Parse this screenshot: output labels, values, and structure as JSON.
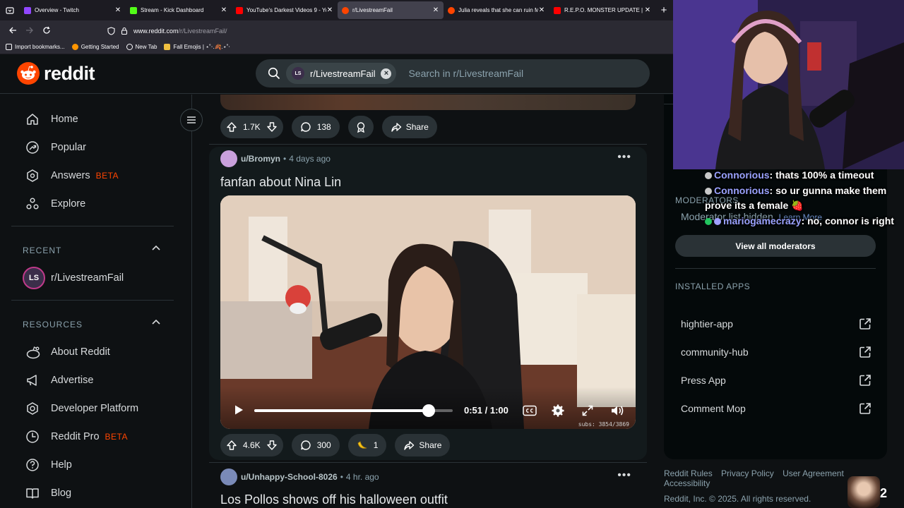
{
  "browser": {
    "tabs": [
      {
        "label": "Overview - Twitch",
        "color": "#9147ff",
        "active": false
      },
      {
        "label": "Stream - Kick Dashboard",
        "color": "#53fc18",
        "active": false
      },
      {
        "label": "YouTube's Darkest Videos 9 - Yo",
        "color": "#ff0000",
        "active": false
      },
      {
        "label": "r/LivestreamFail",
        "color": "#ff4500",
        "active": true
      },
      {
        "label": "Julia reveals that she can ruin M",
        "color": "#ff4500",
        "active": false
      },
      {
        "label": "R.E.P.O. MONSTER UPDATE | La",
        "color": "#ff0000",
        "active": false
      }
    ],
    "url_domain": "www.reddit.com",
    "url_path": "/r/LivestreamFail/",
    "bookmarks": [
      "Import bookmarks...",
      "Getting Started",
      "New Tab",
      "Fall Emojis | ⋆˚‧.🍂.⋆˚‧"
    ]
  },
  "header": {
    "brand": "reddit",
    "search_chip": "r/LivestreamFail",
    "search_chip_avatar": "LS",
    "search_placeholder": "Search in r/LivestreamFail"
  },
  "leftnav": {
    "items": [
      {
        "label": "Home",
        "icon": "home-icon"
      },
      {
        "label": "Popular",
        "icon": "popular-icon"
      },
      {
        "label": "Answers",
        "icon": "answers-icon",
        "badge": "BETA"
      },
      {
        "label": "Explore",
        "icon": "explore-icon"
      }
    ],
    "recent_heading": "RECENT",
    "recent": [
      {
        "label": "r/LivestreamFail",
        "avatar": "LS"
      }
    ],
    "resources_heading": "RESOURCES",
    "resources": [
      {
        "label": "About Reddit",
        "icon": "reddit-alien-icon"
      },
      {
        "label": "Advertise",
        "icon": "megaphone-icon"
      },
      {
        "label": "Developer Platform",
        "icon": "developer-icon"
      },
      {
        "label": "Reddit Pro",
        "icon": "reddit-pro-icon",
        "badge": "BETA"
      },
      {
        "label": "Help",
        "icon": "help-icon"
      },
      {
        "label": "Blog",
        "icon": "blog-icon"
      }
    ]
  },
  "feed": {
    "prev_post": {
      "votes": "1.7K",
      "comments": "138",
      "share": "Share"
    },
    "post1": {
      "author": "u/Bromyn",
      "age": "4 days ago",
      "title": "fanfan about Nina Lin",
      "video_time": "0:51 / 1:00",
      "video_progress": 0.88,
      "overlay_subs": "subs: 3854/3869",
      "votes": "4.6K",
      "comments": "300",
      "award_count": "1",
      "share": "Share"
    },
    "post2": {
      "author": "u/Unhappy-School-8026",
      "age": "4 hr. ago",
      "title": "Los Pollos shows off his halloween outfit"
    }
  },
  "sidebar": {
    "moderators_heading": "MODERATORS",
    "moderator_hidden": "Moderator list hidden.",
    "learn_more": "Learn More",
    "view_all": "View all moderators",
    "apps_heading": "INSTALLED APPS",
    "apps": [
      "hightier-app",
      "community-hub",
      "Press App",
      "Comment Mop"
    ]
  },
  "footer": {
    "links": [
      "Reddit Rules",
      "Privacy Policy",
      "User Agreement",
      "Accessibility"
    ],
    "copyright": "Reddit, Inc. © 2025. All rights reserved."
  },
  "stream_overlay": {
    "chat": [
      {
        "user": "Connorious",
        "text": ": thats 100% a timeout"
      },
      {
        "user": "Connorious",
        "text": ": so ur gunna make them prove its a female 🍓"
      },
      {
        "user": "mariogamecrazy",
        "text": ": no, connor is right"
      }
    ],
    "viewer_badge": "2"
  },
  "colors": {
    "accent": "#ff4500",
    "chat_user": "#9aa2ff"
  }
}
